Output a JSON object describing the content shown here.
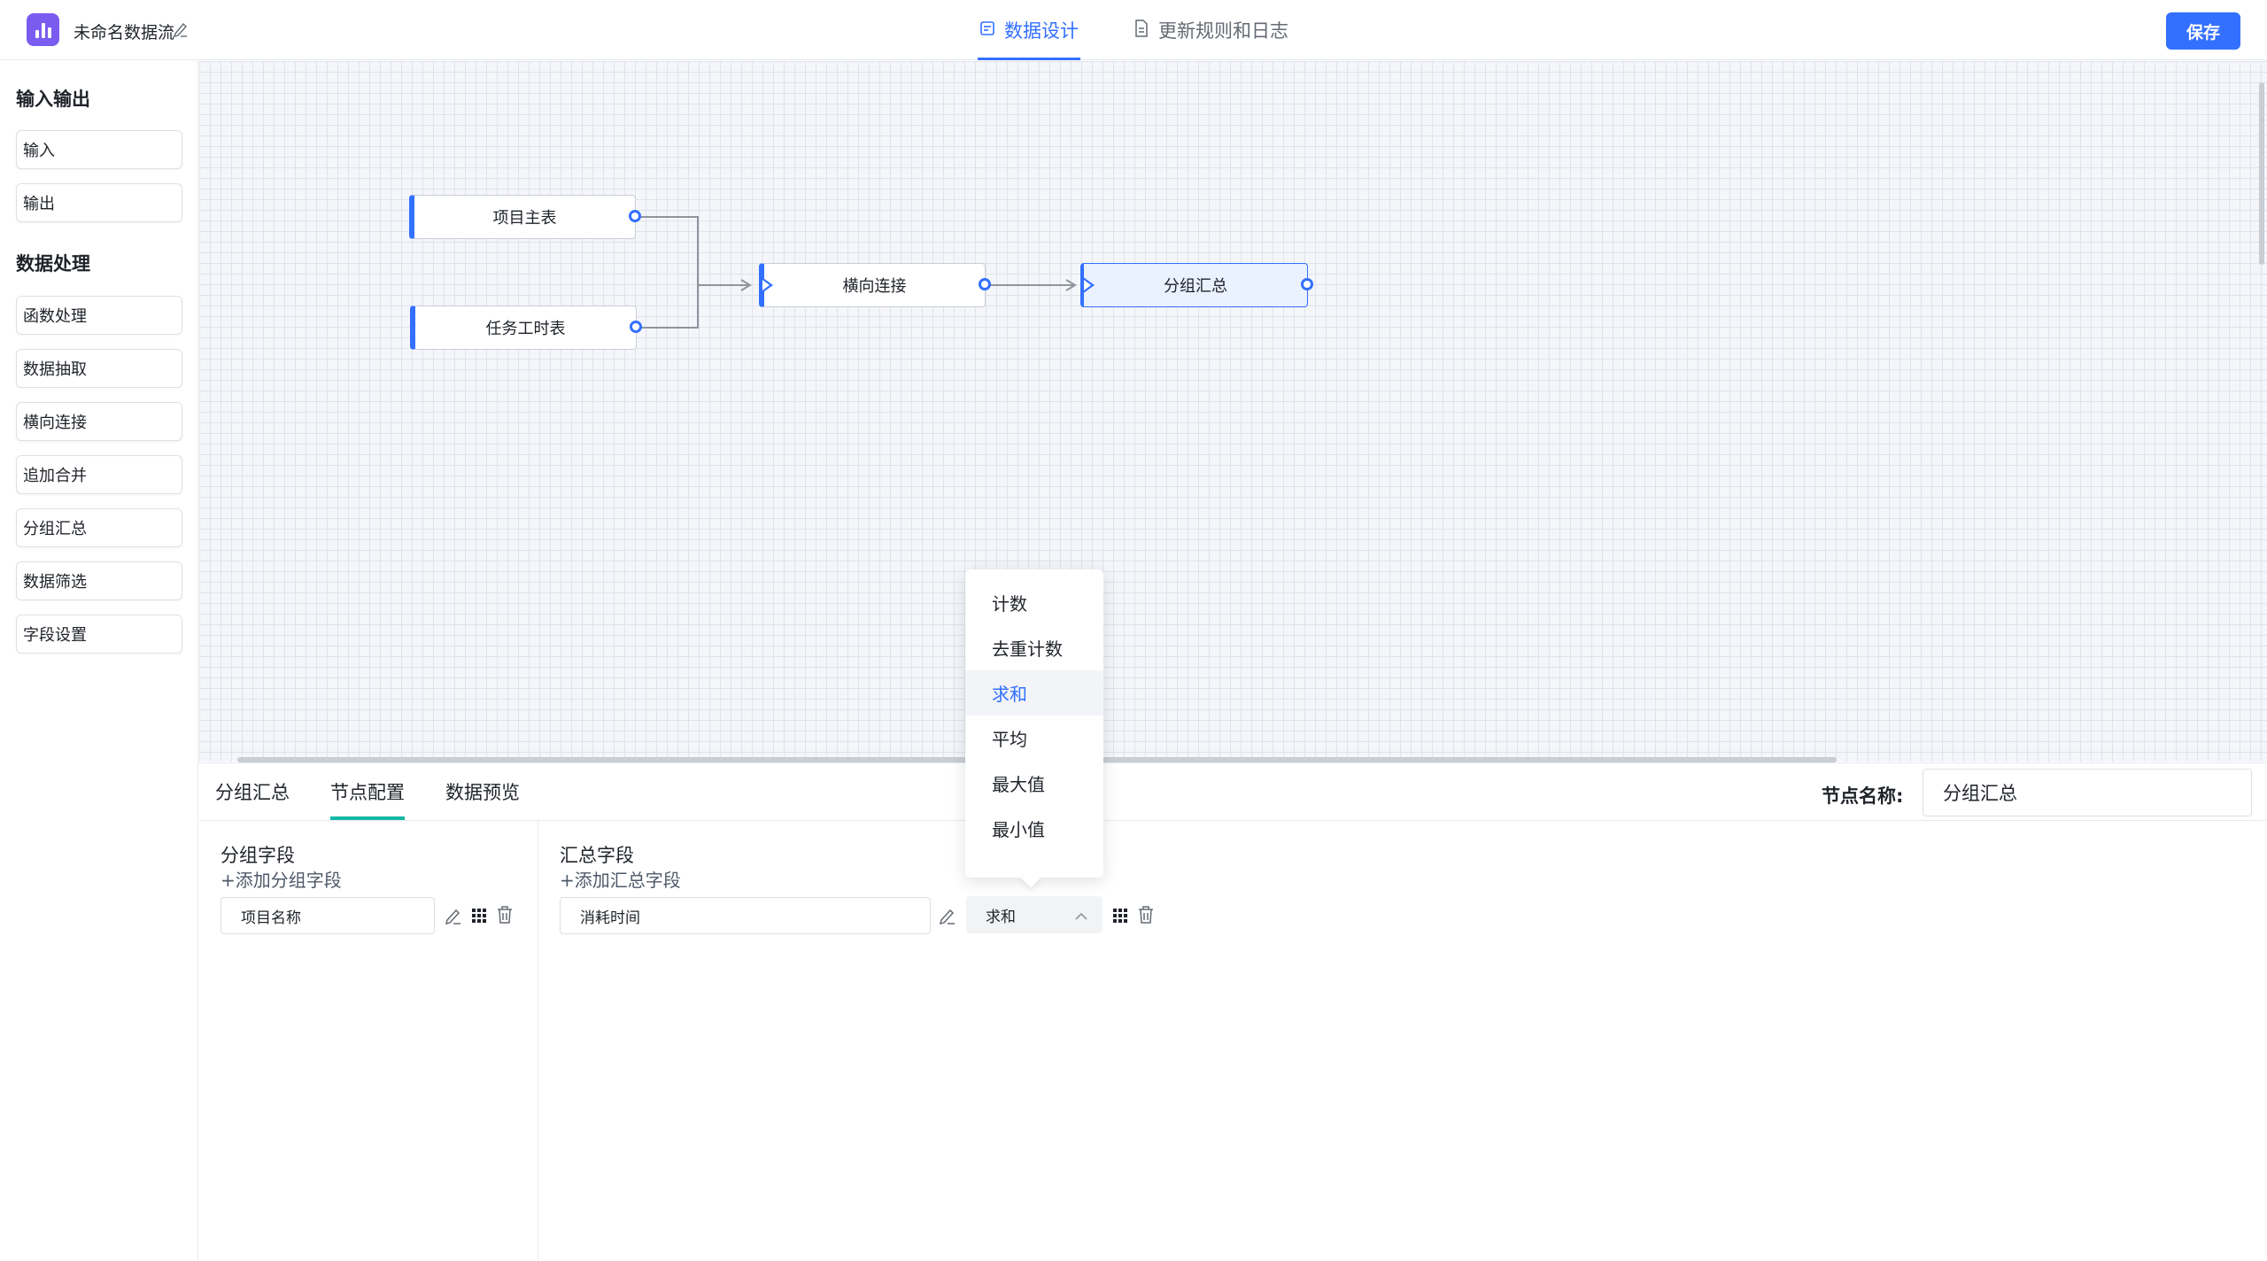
{
  "header": {
    "app_title": "未命名数据流",
    "tabs": [
      {
        "label": "数据设计",
        "icon": "design-icon",
        "active": true
      },
      {
        "label": "更新规则和日志",
        "icon": "document-icon",
        "active": false
      }
    ],
    "save_label": "保存",
    "accent_color": "#3370ff"
  },
  "sidebar": {
    "io_title": "输入输出",
    "io_items": [
      "输入",
      "输出"
    ],
    "process_title": "数据处理",
    "process_items": [
      "函数处理",
      "数据抽取",
      "横向连接",
      "追加合并",
      "分组汇总",
      "数据筛选",
      "字段设置"
    ]
  },
  "canvas": {
    "nodes": [
      {
        "label": "项目主表"
      },
      {
        "label": "任务工时表"
      },
      {
        "label": "横向连接"
      },
      {
        "label": "分组汇总",
        "selected": true
      }
    ]
  },
  "bottom": {
    "tabs": [
      "分组汇总",
      "节点配置",
      "数据预览"
    ],
    "active_tab": "节点配置",
    "tab_indicator_color": "#14b8a6",
    "node_name_label": "节点名称:",
    "node_name_value": "分组汇总",
    "group": {
      "title": "分组字段",
      "add_label": "+添加分组字段",
      "fields": [
        "项目名称"
      ]
    },
    "summary": {
      "title": "汇总字段",
      "add_label": "+添加汇总字段",
      "fields": [
        {
          "name": "消耗时间",
          "aggregation": "求和"
        }
      ]
    }
  },
  "dropdown": {
    "options": [
      "计数",
      "去重计数",
      "求和",
      "平均",
      "最大值",
      "最小值"
    ],
    "selected": "求和"
  }
}
